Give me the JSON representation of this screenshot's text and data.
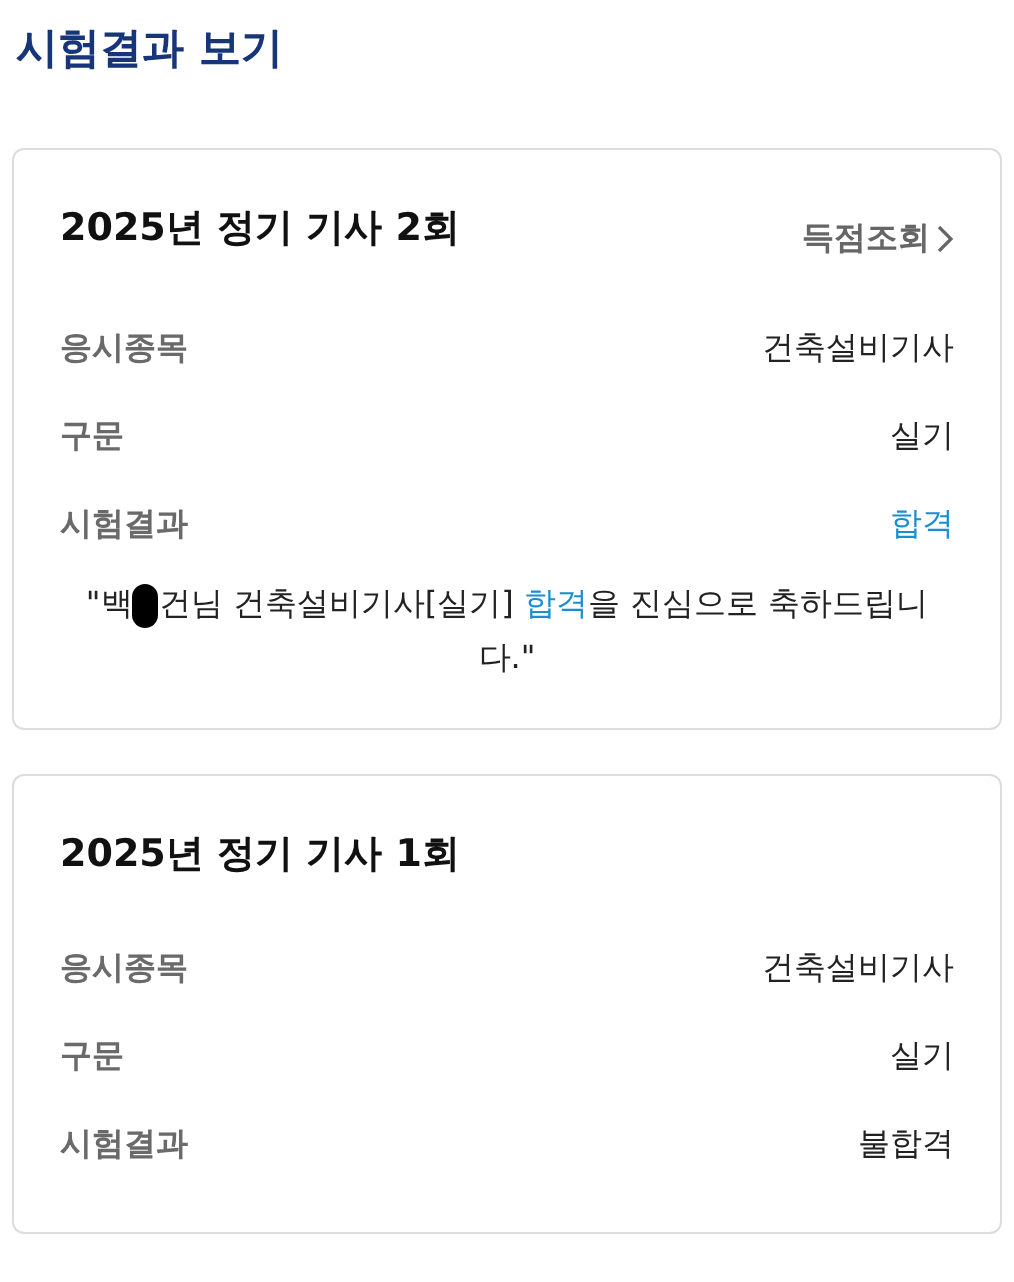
{
  "title": "시험결과 보기",
  "exams": [
    {
      "title": "2025년 정기 기사 2회",
      "score_link": "득점조회",
      "fields": [
        {
          "label": "응시종목",
          "value": "건축설비기사",
          "passed": false
        },
        {
          "label": "구문",
          "value": "실기",
          "passed": false
        },
        {
          "label": "시험결과",
          "value": "합격",
          "passed": true
        }
      ],
      "message": {
        "before": "\"백",
        "after_name": "건님 건축설비기사[실기]",
        "highlight": "합격",
        "end": "을 진심으로 축하드립니다.\""
      }
    },
    {
      "title": "2025년 정기 기사 1회",
      "fields": [
        {
          "label": "응시종목",
          "value": "건축설비기사",
          "passed": false
        },
        {
          "label": "구문",
          "value": "실기",
          "passed": false
        },
        {
          "label": "시험결과",
          "value": "불합격",
          "passed": false
        }
      ]
    }
  ]
}
